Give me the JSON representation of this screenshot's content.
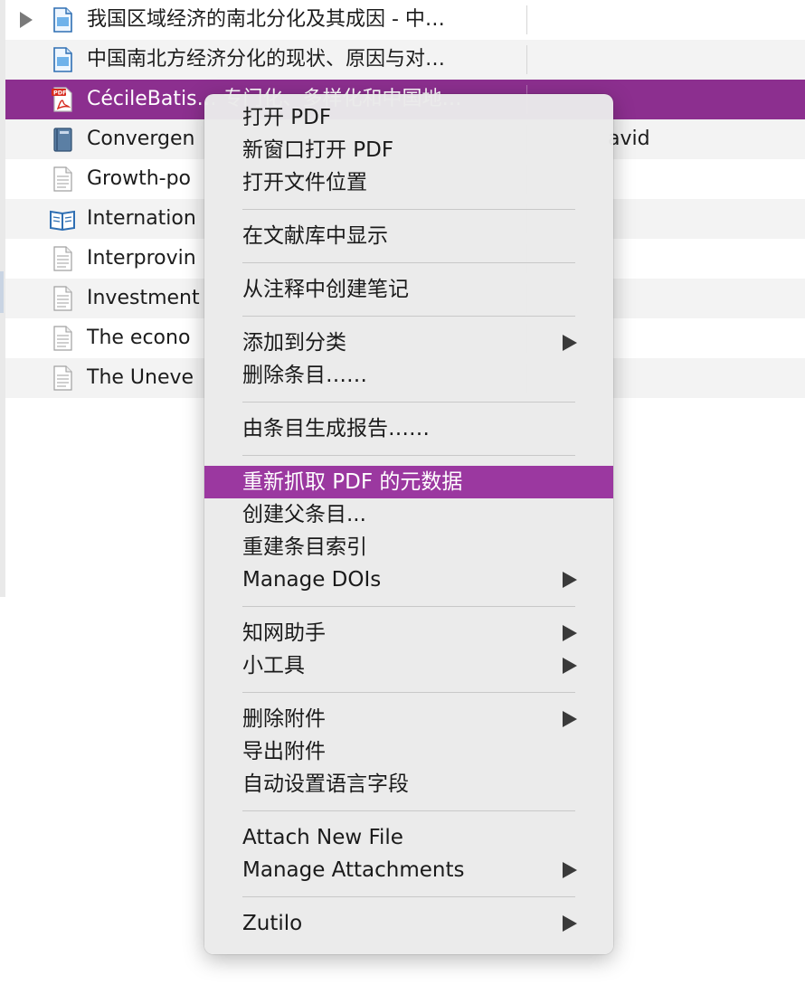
{
  "items": [
    {
      "title": "我国区域经济的南北分化及其成因 - 中…",
      "icon": "document-icon",
      "has_children": true,
      "extra": ""
    },
    {
      "title": "中国南北方经济分化的现状、原因与对…",
      "icon": "document-icon",
      "has_children": false,
      "extra": ""
    },
    {
      "title": "CécileBatis… 专门化、多样化和中国地…",
      "icon": "pdf-icon",
      "has_children": false,
      "extra": ""
    },
    {
      "title": "Convergen",
      "icon": "book-icon",
      "has_children": false,
      "extra": "avid"
    },
    {
      "title": "Growth-po",
      "icon": "page-icon",
      "has_children": false,
      "extra": ""
    },
    {
      "title": "Internation",
      "icon": "open-book-icon",
      "has_children": false,
      "extra": ""
    },
    {
      "title": "Interprovin",
      "icon": "page-icon",
      "has_children": false,
      "extra": ""
    },
    {
      "title": "Investment",
      "icon": "page-icon",
      "has_children": false,
      "extra": ""
    },
    {
      "title": "The econo",
      "icon": "page-icon",
      "has_children": false,
      "extra": ""
    },
    {
      "title": "The Uneve",
      "icon": "page-icon",
      "has_children": false,
      "extra": ""
    }
  ],
  "selected_index": 2,
  "menu": [
    {
      "label": "打开 PDF"
    },
    {
      "label": "新窗口打开 PDF"
    },
    {
      "label": "打开文件位置"
    },
    {
      "separator": true
    },
    {
      "label": "在文献库中显示"
    },
    {
      "separator": true
    },
    {
      "label": "从注释中创建笔记"
    },
    {
      "separator": true
    },
    {
      "label": "添加到分类",
      "submenu": true
    },
    {
      "label": "删除条目……"
    },
    {
      "separator": true
    },
    {
      "label": "由条目生成报告……"
    },
    {
      "separator": true
    },
    {
      "label": "重新抓取 PDF 的元数据",
      "highlighted": true
    },
    {
      "label": "创建父条目..."
    },
    {
      "label": "重建条目索引"
    },
    {
      "label": "Manage DOIs",
      "submenu": true
    },
    {
      "separator": true
    },
    {
      "label": "知网助手",
      "submenu": true
    },
    {
      "label": "小工具",
      "submenu": true
    },
    {
      "separator": true
    },
    {
      "label": "删除附件",
      "submenu": true
    },
    {
      "label": "导出附件"
    },
    {
      "label": "自动设置语言字段"
    },
    {
      "separator": true
    },
    {
      "label": "Attach New File"
    },
    {
      "label": "Manage Attachments",
      "submenu": true
    },
    {
      "separator": true
    },
    {
      "label": "Zutilo",
      "submenu": true
    }
  ],
  "colors": {
    "selection": "#8c2f8f",
    "menu_highlight": "#9b38a0",
    "menu_bg": "#eaeaea"
  }
}
